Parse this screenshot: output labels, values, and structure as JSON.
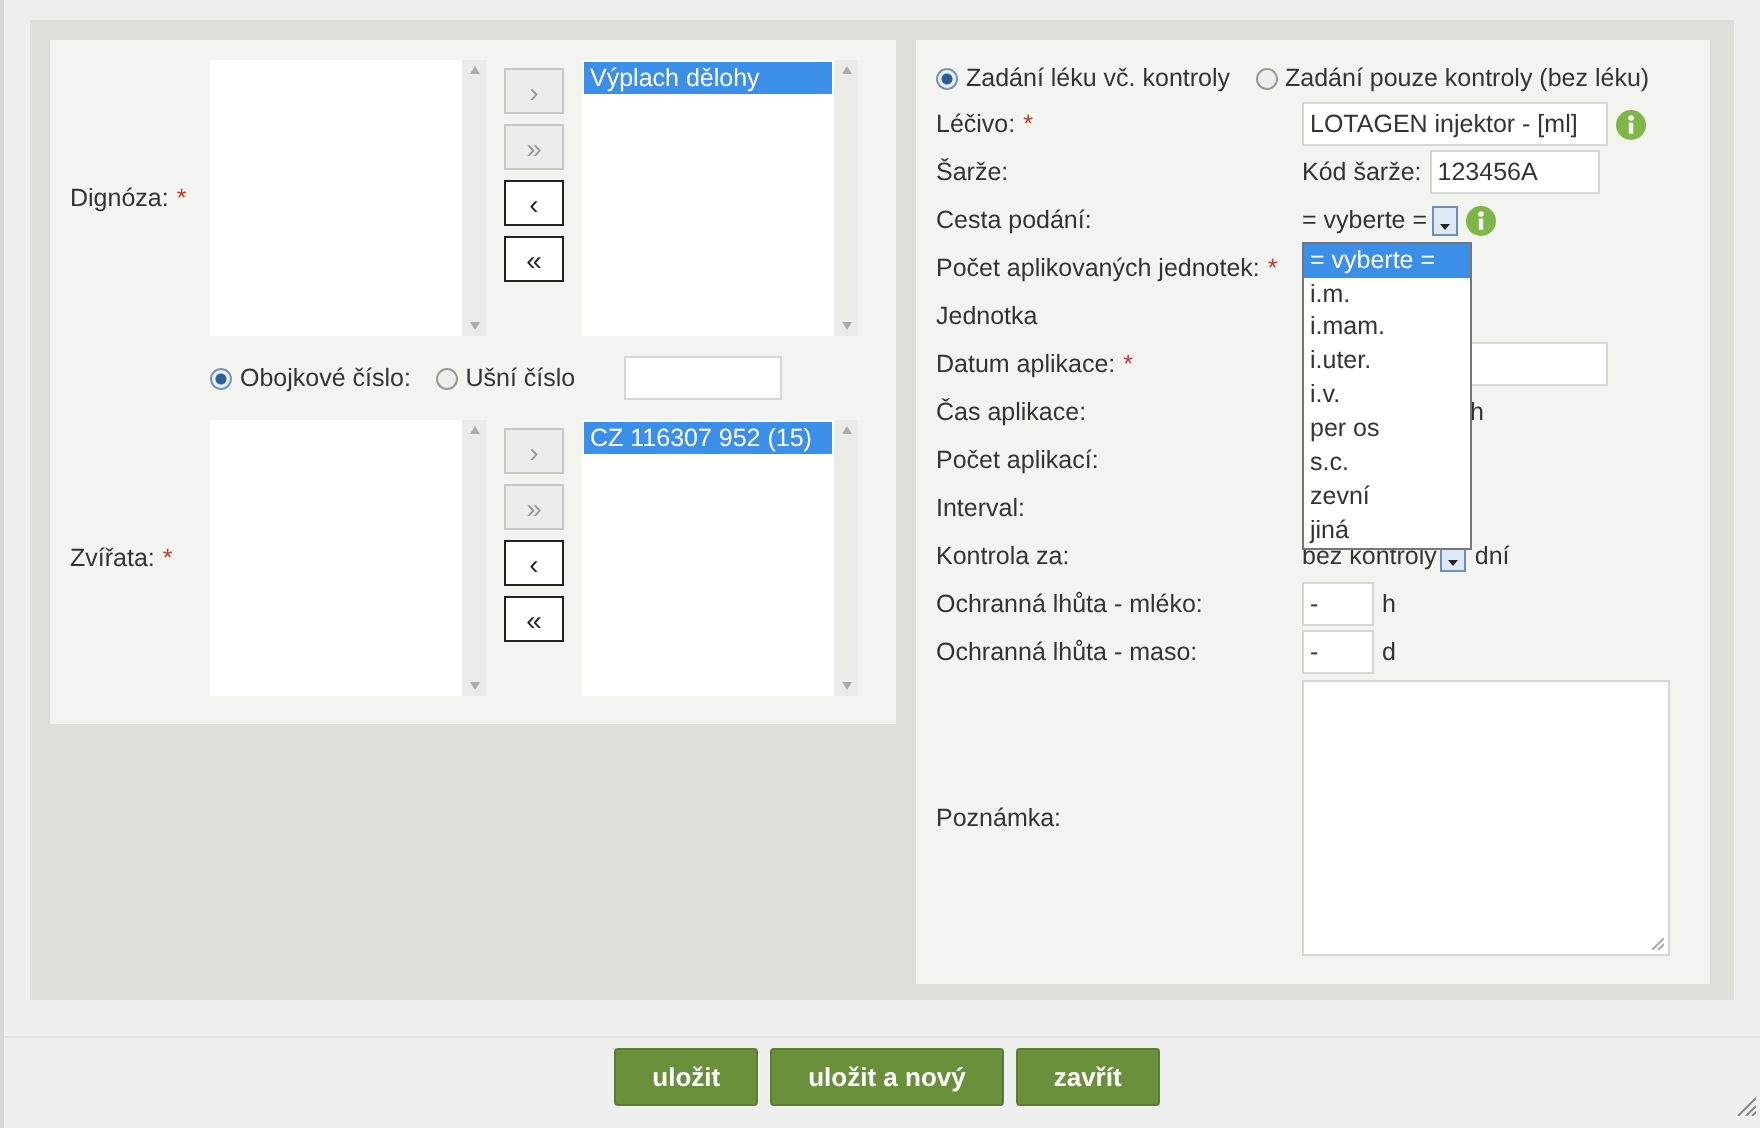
{
  "left_panel": {
    "diagnosis": {
      "label": "Dignóza:",
      "required_mark": "*",
      "chosen": [
        {
          "text": "Výplach dělohy",
          "selected": true
        }
      ],
      "move_buttons": [
        {
          "label": "›",
          "disabled": true
        },
        {
          "label": "»",
          "disabled": true
        },
        {
          "label": "‹",
          "disabled": false
        },
        {
          "label": "«",
          "disabled": false
        }
      ]
    },
    "id_type": [
      {
        "label": "Obojkové číslo:",
        "selected": true
      },
      {
        "label": "Ušní číslo",
        "selected": false
      }
    ],
    "animals": {
      "label": "Zvířata:",
      "required_mark": "*",
      "chosen": [
        {
          "text": "CZ 116307 952 (15)",
          "selected": true
        }
      ],
      "move_buttons": [
        {
          "label": "›",
          "disabled": true
        },
        {
          "label": "»",
          "disabled": true
        },
        {
          "label": "‹",
          "disabled": false
        },
        {
          "label": "«",
          "disabled": false
        }
      ]
    }
  },
  "right_panel": {
    "mode": [
      {
        "label": "Zadání léku vč. kontroly",
        "selected": true
      },
      {
        "label": "Zadání pouze kontroly (bez léku)",
        "selected": false
      }
    ],
    "rows": [
      {
        "kind": "text",
        "label": "Léčivo:",
        "required_mark": "*",
        "value": "LOTAGEN injektor - [ml]",
        "info": true
      },
      {
        "kind": "prefixed",
        "label": "Šarže:",
        "prefix": "Kód šarže:",
        "value": "123456A"
      },
      {
        "kind": "select",
        "label": "Cesta podání:",
        "value": "= vyberte =",
        "info": true,
        "open": true,
        "options": [
          {
            "text": "= vyberte =",
            "selected": true
          },
          {
            "text": "i.m.",
            "selected": false
          },
          {
            "text": "i.mam.",
            "selected": false
          },
          {
            "text": "i.uter.",
            "selected": false
          },
          {
            "text": "i.v.",
            "selected": false
          },
          {
            "text": "per os",
            "selected": false
          },
          {
            "text": "s.c.",
            "selected": false
          },
          {
            "text": "zevní",
            "selected": false
          },
          {
            "text": "jiná",
            "selected": false
          }
        ]
      },
      {
        "kind": "covered",
        "label": "Počet aplikovaných jednotek:",
        "required_mark": "*"
      },
      {
        "kind": "covered",
        "label": "Jednotka"
      },
      {
        "kind": "wide",
        "label": "Datum aplikace:",
        "required_mark": "*"
      },
      {
        "kind": "unit",
        "label": "Čas aplikace:",
        "unit": "h"
      },
      {
        "kind": "covered",
        "label": "Počet aplikací:"
      },
      {
        "kind": "covered",
        "label": "Interval:"
      },
      {
        "kind": "select",
        "label": "Kontrola za:",
        "value": "bez kontroly",
        "unit": "dní"
      },
      {
        "kind": "unit",
        "label": "Ochranná lhůta - mléko:",
        "value": "-",
        "unit": "h"
      },
      {
        "kind": "unit",
        "label": "Ochranná lhůta - maso:",
        "value": "-",
        "unit": "d"
      },
      {
        "kind": "textarea",
        "label": "Poznámka:"
      }
    ]
  },
  "buttons": [
    {
      "label": "uložit"
    },
    {
      "label": "uložit a nový"
    },
    {
      "label": "zavřít"
    }
  ]
}
